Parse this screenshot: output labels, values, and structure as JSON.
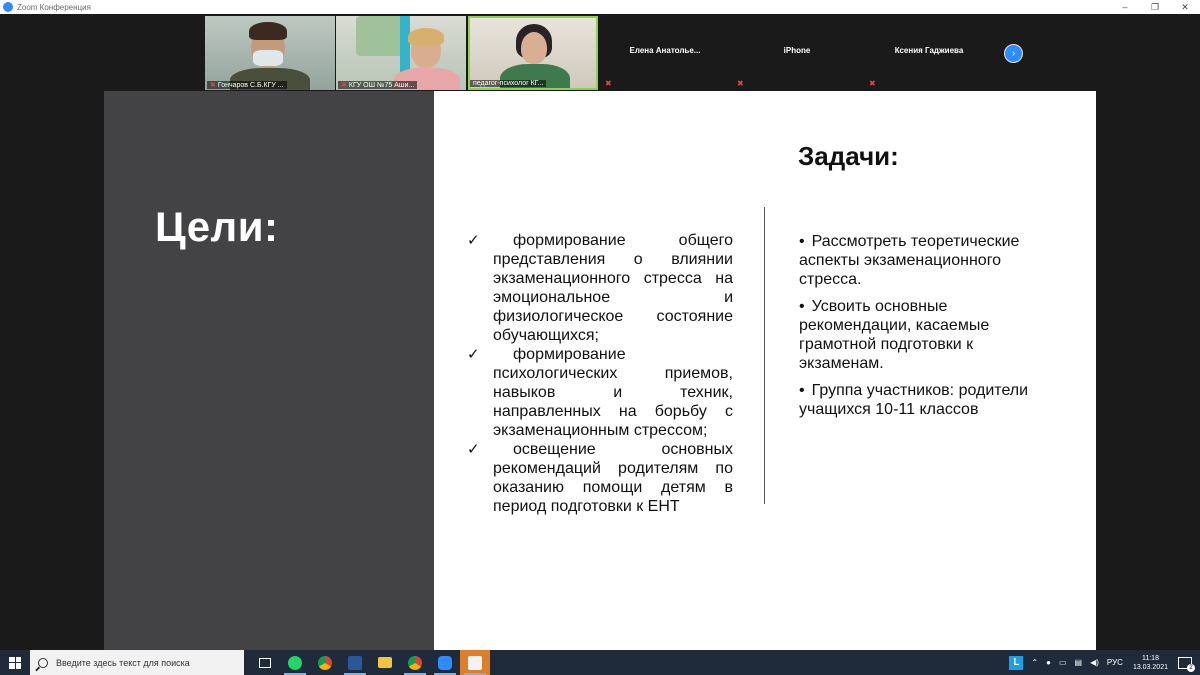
{
  "window": {
    "title": "Zoom Конференция",
    "controls": [
      "–",
      "❐",
      "✕"
    ]
  },
  "participants": {
    "video_tiles": [
      {
        "name": "Гончаров С.Б.КГУ ..."
      },
      {
        "name": "КГУ ОШ №75 Аши..."
      },
      {
        "name": "педагог-психолог КГ..."
      }
    ],
    "text_tiles": [
      {
        "name": "Елена  Анатолье..."
      },
      {
        "name": "iPhone"
      },
      {
        "name": "Ксения Гаджиева"
      }
    ],
    "next_icon": "›"
  },
  "slide": {
    "goals_title": "Цели:",
    "tasks_title": "Задачи:",
    "goals": [
      "формирование общего представления о влиянии экзаменационного стресса на эмоциональное и физиологическое состояние обучающихся;",
      "формирование психологических приемов, навыков и техник, направленных на борьбу с экзаменационным стрессом;",
      "освещение основных рекомендаций родителям по оказанию помощи детям в период подготовки к ЕНТ"
    ],
    "check_mark": "✓",
    "bullet_mark": "•",
    "tasks": [
      "Рассмотреть теоретические аспекты экзаменационного стресса.",
      "Усвоить основные рекомендации, касаемые грамотной подготовки к экзаменам.",
      "Группа участников: родители учащихся 10-11 классов"
    ]
  },
  "taskbar": {
    "search_placeholder": "Введите здесь текст для поиска",
    "apps": [
      "task-view",
      "whatsapp",
      "chrome",
      "word",
      "file-explorer",
      "chrome-2",
      "zoom",
      "notepad"
    ],
    "tray": {
      "l_badge": "L",
      "language": "РУС",
      "time": "11:18",
      "date": "13.03.2021",
      "notifications": "2"
    }
  }
}
